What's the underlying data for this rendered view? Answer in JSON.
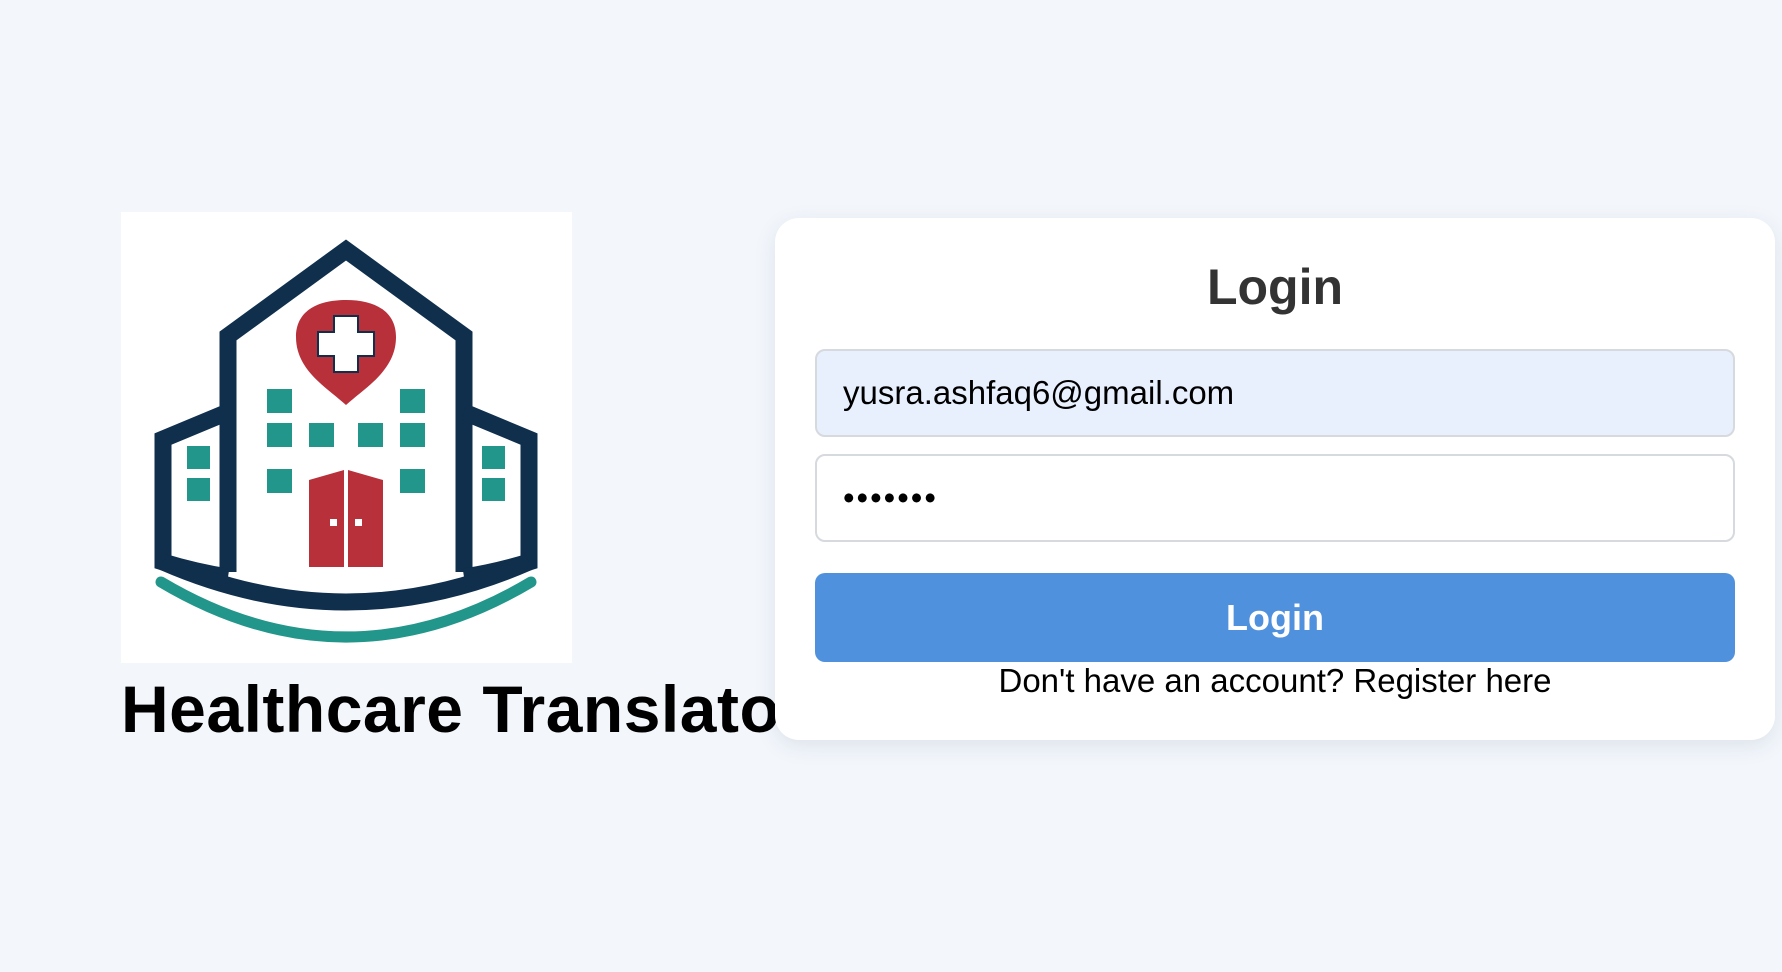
{
  "brand": {
    "app_title": "Healthcare Translator",
    "logo_icon": "hospital-building-icon",
    "colors": {
      "navy": "#0f2f4d",
      "teal": "#22968a",
      "red": "#b8303a"
    }
  },
  "login_form": {
    "title": "Login",
    "email_value": "yusra.ashfaq6@gmail.com",
    "password_value": "•••••••",
    "submit_label": "Login",
    "register_prompt": "Don't have an account?",
    "register_link": "Register here",
    "accent_color": "#4f91dd"
  }
}
